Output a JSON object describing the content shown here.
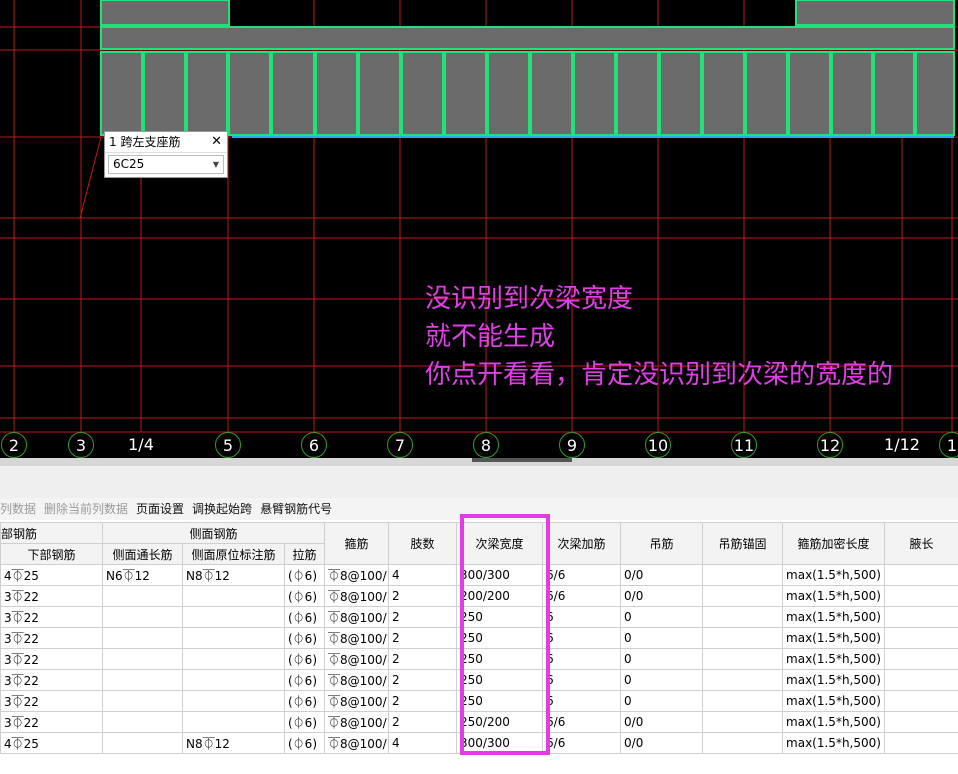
{
  "canvas": {
    "annotation_lines": [
      "没识别到次梁宽度",
      "就不能生成",
      "你点开看看，肯定没识别到次梁的宽度的"
    ],
    "axis_labels": [
      "2",
      "3",
      "1/4",
      "5",
      "6",
      "7",
      "8",
      "9",
      "10",
      "11",
      "12",
      "1/12",
      "1"
    ],
    "popup": {
      "title": "1 跨左支座筋",
      "value": "6C25",
      "close_symbol": "✕",
      "dropdown_symbol": "▼"
    }
  },
  "toolbar": {
    "items": [
      {
        "label": "列数据",
        "enabled": false
      },
      {
        "label": "删除当前列数据",
        "enabled": false
      },
      {
        "label": "页面设置",
        "enabled": true
      },
      {
        "label": "调换起始跨",
        "enabled": true
      },
      {
        "label": "悬臂钢筋代号",
        "enabled": true
      }
    ]
  },
  "table": {
    "group_headers": [
      "部钢筋",
      "侧面钢筋"
    ],
    "columns": [
      "下部钢筋",
      "侧面通长筋",
      "侧面原位标注筋",
      "拉筋",
      "箍筋",
      "肢数",
      "次梁宽度",
      "次梁加筋",
      "吊筋",
      "吊筋锚固",
      "箍筋加密长度",
      "腋长"
    ],
    "rows": [
      [
        "4⏁25",
        "N6⏁12",
        "N8⏁12",
        "(⏀6)",
        "⏁8@100/",
        "4",
        "300/300",
        "6/6",
        "0/0",
        "",
        "max(1.5*h,500)",
        ""
      ],
      [
        "3⏁22",
        "",
        "",
        "(⏀6)",
        "⏁8@100/",
        "2",
        "200/200",
        "6/6",
        "0/0",
        "",
        "max(1.5*h,500)",
        ""
      ],
      [
        "3⏁22",
        "",
        "",
        "(⏀6)",
        "⏁8@100/",
        "2",
        "250",
        "6",
        "0",
        "",
        "max(1.5*h,500)",
        ""
      ],
      [
        "3⏁22",
        "",
        "",
        "(⏀6)",
        "⏁8@100/",
        "2",
        "250",
        "6",
        "0",
        "",
        "max(1.5*h,500)",
        ""
      ],
      [
        "3⏁22",
        "",
        "",
        "(⏀6)",
        "⏁8@100/",
        "2",
        "250",
        "6",
        "0",
        "",
        "max(1.5*h,500)",
        ""
      ],
      [
        "3⏁22",
        "",
        "",
        "(⏀6)",
        "⏁8@100/",
        "2",
        "250",
        "6",
        "0",
        "",
        "max(1.5*h,500)",
        ""
      ],
      [
        "3⏁22",
        "",
        "",
        "(⏀6)",
        "⏁8@100/",
        "2",
        "250",
        "6",
        "0",
        "",
        "max(1.5*h,500)",
        ""
      ],
      [
        "3⏁22",
        "",
        "",
        "(⏀6)",
        "⏁8@100/",
        "2",
        "250/200",
        "6/6",
        "0/0",
        "",
        "max(1.5*h,500)",
        ""
      ],
      [
        "4⏁25",
        "",
        "N8⏁12",
        "(⏀6)",
        "⏁8@100/",
        "4",
        "300/300",
        "6/6",
        "0/0",
        "",
        "max(1.5*h,500)",
        ""
      ]
    ]
  },
  "colors": {
    "canvas_bg": "#000000",
    "grid_line": "#c4161c",
    "beam_outline": "#22e07a",
    "slab_fill": "#6b6b6b",
    "annotation": "#e03ee6",
    "highlight_box": "#e53be6"
  }
}
